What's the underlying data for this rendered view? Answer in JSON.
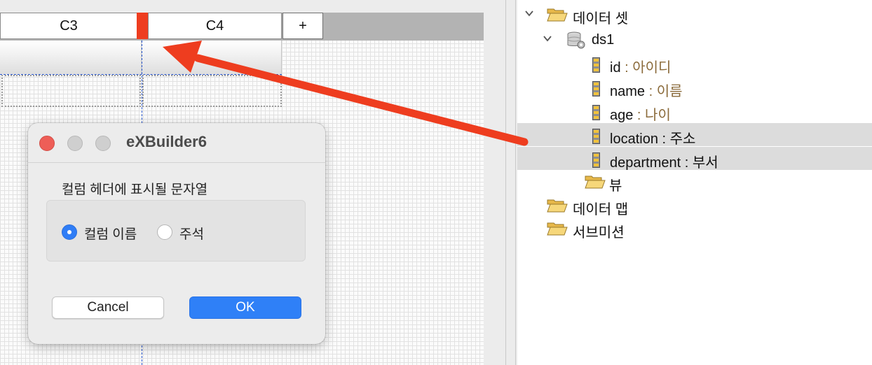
{
  "grid": {
    "columns": [
      {
        "label": "C3"
      },
      {
        "label": "C4"
      }
    ],
    "add_label": "+"
  },
  "dialog": {
    "title": "eXBuilder6",
    "prompt": "컬럼 헤더에 표시될 문자열",
    "options": [
      {
        "label": "컬럼 이름",
        "selected": true
      },
      {
        "label": "주석",
        "selected": false
      }
    ],
    "cancel_label": "Cancel",
    "ok_label": "OK"
  },
  "tree": {
    "dataset_folder": "데이터 셋",
    "dataset": "ds1",
    "fields": [
      {
        "name": "id",
        "sep": " : ",
        "comment": "아이디",
        "selected": false
      },
      {
        "name": "name",
        "sep": " : ",
        "comment": "이름",
        "selected": false
      },
      {
        "name": "age",
        "sep": " : ",
        "comment": "나이",
        "selected": false
      },
      {
        "name": "location",
        "sep": " : ",
        "comment": "주소",
        "selected": true
      },
      {
        "name": "department",
        "sep": " : ",
        "comment": "부서",
        "selected": true
      }
    ],
    "view_folder": "뷰",
    "datamap_folder": "데이터 맵",
    "submission_folder": "서브미션"
  },
  "colors": {
    "accent_red": "#ee3d1f",
    "ok_blue": "#2f80f7",
    "comment_brown": "#8a6a3a",
    "selection_gray": "#dcdcdc"
  }
}
